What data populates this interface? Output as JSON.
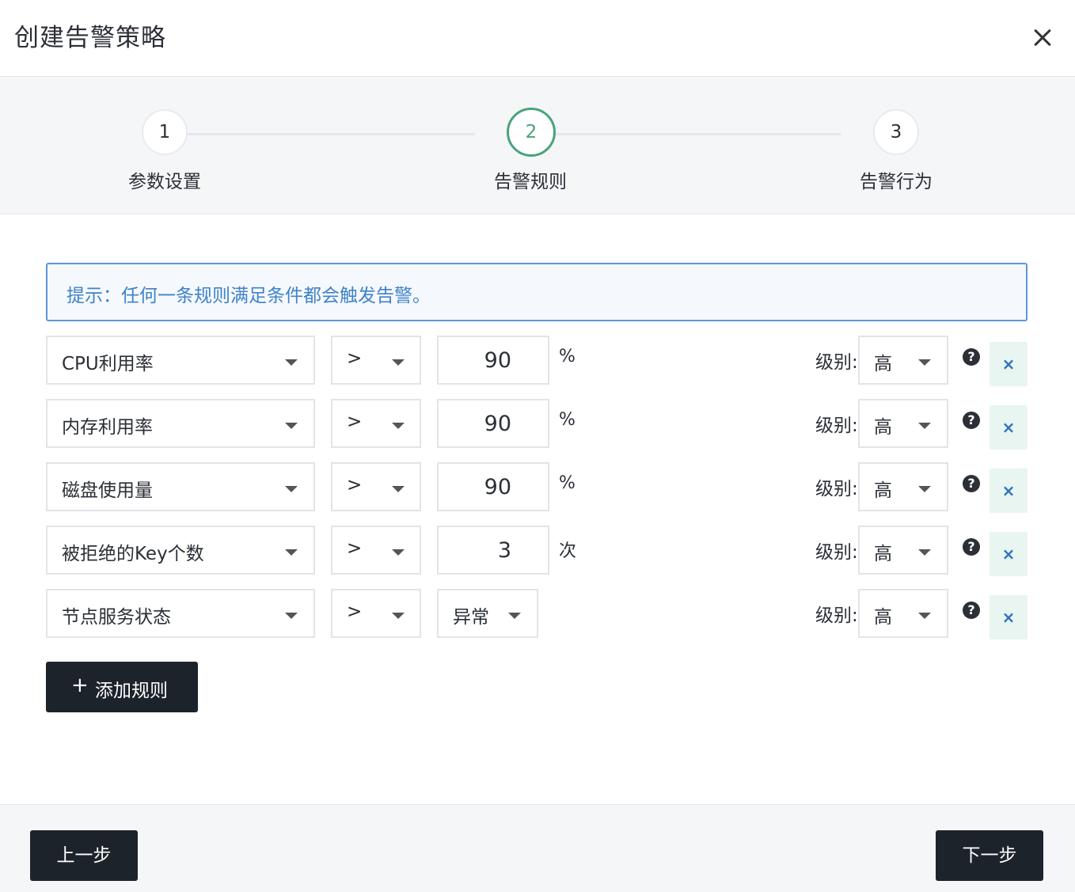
{
  "dialog": {
    "title": "创建告警策略"
  },
  "steps": [
    {
      "number": "1",
      "label": "参数设置"
    },
    {
      "number": "2",
      "label": "告警规则"
    },
    {
      "number": "3",
      "label": "告警行为"
    }
  ],
  "tip": "提示：任何一条规则满足条件都会触发告警。",
  "level_label": "级别:",
  "rules": [
    {
      "metric": "CPU利用率",
      "operator": ">",
      "value": "90",
      "unit": "%",
      "level": "高"
    },
    {
      "metric": "内存利用率",
      "operator": ">",
      "value": "90",
      "unit": "%",
      "level": "高"
    },
    {
      "metric": "磁盘使用量",
      "operator": ">",
      "value": "90",
      "unit": "%",
      "level": "高"
    },
    {
      "metric": "被拒绝的Key个数",
      "operator": ">",
      "value": "3",
      "unit": "次",
      "level": "高"
    },
    {
      "metric": "节点服务状态",
      "operator": ">",
      "value_select": "异常",
      "level": "高"
    }
  ],
  "add_rule_label": "添加规则",
  "footer": {
    "prev_label": "上一步",
    "next_label": "下一步"
  }
}
